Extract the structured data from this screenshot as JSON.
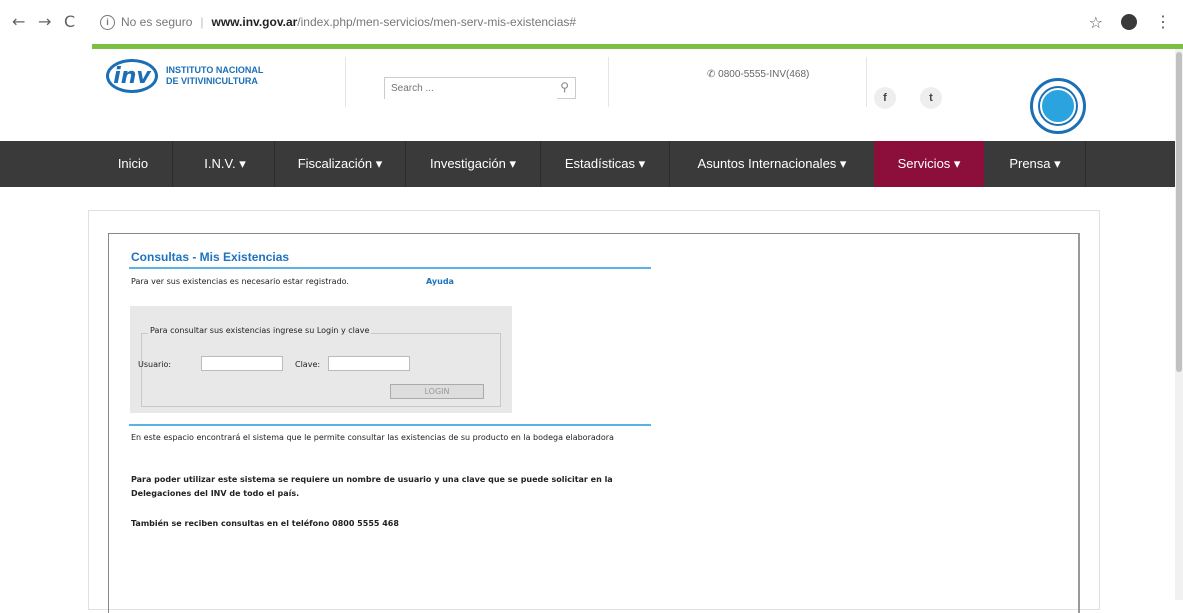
{
  "browser": {
    "not_secure": "No es seguro",
    "host": "www.inv.gov.ar",
    "path": "/index.php/men-servicios/men-serv-mis-existencias#"
  },
  "header": {
    "logo_line1": "INSTITUTO NACIONAL",
    "logo_line2": "DE VITIVINICULTURA",
    "search_placeholder": "Search ...",
    "phone": "0800-5555-INV(468)",
    "social": [
      "f",
      "t"
    ]
  },
  "nav": {
    "items": [
      {
        "label": "Inicio"
      },
      {
        "label": "I.N.V. ▾"
      },
      {
        "label": "Fiscalización ▾"
      },
      {
        "label": "Investigación ▾"
      },
      {
        "label": "Estadísticas ▾"
      },
      {
        "label": "Asuntos Internacionales ▾"
      },
      {
        "label": "Servicios ▾",
        "active": true
      },
      {
        "label": "Prensa ▾"
      }
    ]
  },
  "page": {
    "title": "Consultas - Mis Existencias",
    "intro": "Para ver sus existencias es necesario estar registrado.",
    "help_link": "Ayuda",
    "login_legend": "Para consultar sus existencias ingrese su Login y clave",
    "user_label": "Usuario:",
    "pass_label": "Clave:",
    "login_button": "LOGIN",
    "info1": "En este espacio encontrará el sistema que le permite consultar las existencias de su producto en la bodega elaboradora",
    "info2": "Para poder utilizar este sistema se requiere un nombre de usuario y una clave que se puede solicitar en la Delegaciones del INV de todo el país.",
    "info3": "También se reciben consultas en el teléfono 0800 5555 468"
  },
  "colors": {
    "green_accent": "#7ac143",
    "nav_bg": "#3a3a3a",
    "nav_active": "#8b0f3a",
    "brand_blue": "#1a6fb6"
  }
}
